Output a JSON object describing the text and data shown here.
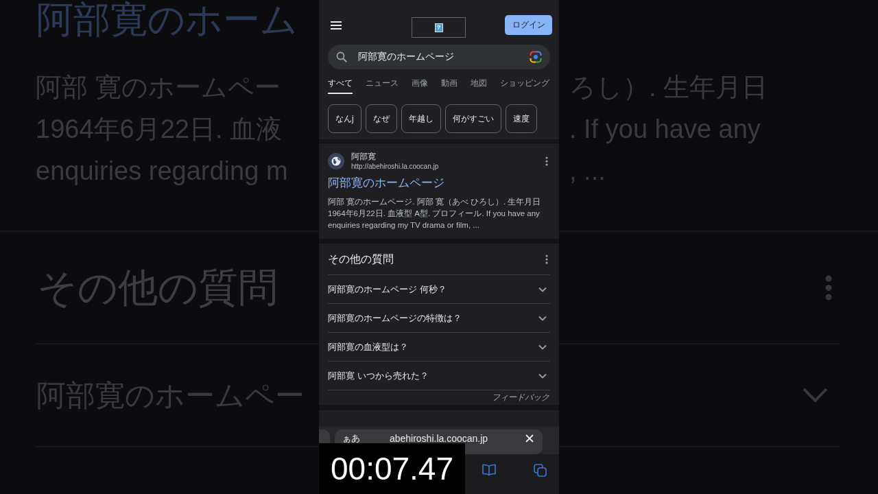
{
  "blurred_backdrop": {
    "left": {
      "title": "阿部寛のホーム",
      "snippet_lines": [
        "阿部 寛のホームペー",
        "1964年6月22日. 血液",
        "enquiries regarding m"
      ],
      "heading": "その他の質問",
      "question": "阿部寛のホームペー"
    },
    "right": {
      "snippet_lines": [
        "ろし）. 生年月日",
        ". If you have any",
        ", ..."
      ]
    }
  },
  "header": {
    "logo_icon": "?",
    "login_button": "ログイン"
  },
  "search": {
    "value": "阿部寛のホームページ"
  },
  "tabs": [
    {
      "label": "すべて",
      "selected": true
    },
    {
      "label": "ニュース",
      "selected": false
    },
    {
      "label": "画像",
      "selected": false
    },
    {
      "label": "動画",
      "selected": false
    },
    {
      "label": "地図",
      "selected": false
    },
    {
      "label": "ショッピング",
      "selected": false
    }
  ],
  "chips": [
    "なんj",
    "なぜ",
    "年越し",
    "何がすごい",
    "速度"
  ],
  "result": {
    "site_name": "阿部寛",
    "url": "http://abehiroshi.la.coocan.jp",
    "title": "阿部寛のホームページ",
    "snippet": "阿部 寛のホームページ. 阿部 寛（あべ ひろし）. 生年月日 1964年6月22日. 血液型 A型. プロフィール. If you have any enquiries regarding my TV drama or film, ..."
  },
  "related_questions": {
    "heading": "その他の質問",
    "items": [
      {
        "question": "阿部寛のホームページ 何秒？",
        "expanded": false
      },
      {
        "question": "阿部寛のホームページの特徴は？",
        "expanded": false
      },
      {
        "question": "阿部寛の血液型は？",
        "expanded": false
      },
      {
        "question": "阿部寛 いつから売れた？",
        "expanded": false
      }
    ],
    "feedback": "フィードバック"
  },
  "browser_bar": {
    "text_size_button": "ぁあ",
    "address": "abehiroshi.la.coocan.jp"
  },
  "timer_overlay": {
    "time": "00:07.47"
  }
}
